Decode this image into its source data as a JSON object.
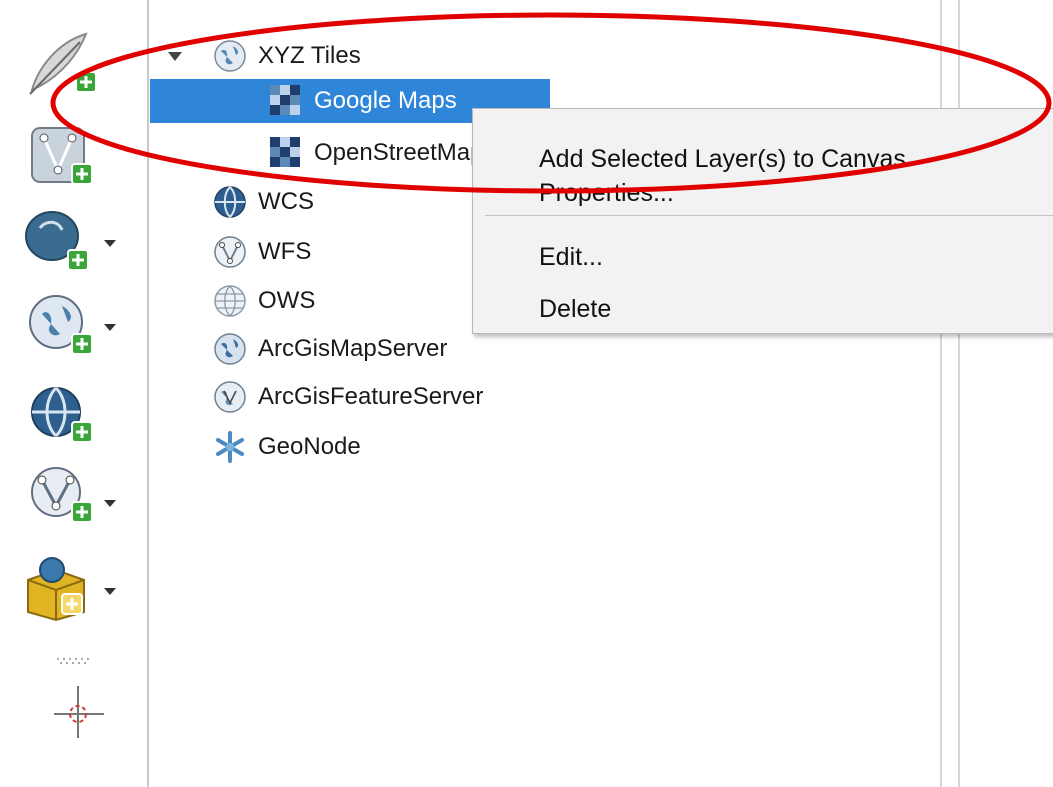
{
  "tree": {
    "xyz_tiles": "XYZ Tiles",
    "google_maps": "Google Maps",
    "openstreetmap": "OpenStreetMap",
    "wcs": "WCS",
    "wfs": "WFS",
    "ows": "OWS",
    "arcgis_map_server": "ArcGisMapServer",
    "arcgis_feature_server": "ArcGisFeatureServer",
    "geonode": "GeoNode"
  },
  "context_menu": {
    "add_selected": "Add Selected Layer(s) to Canvas",
    "properties": "Properties...",
    "edit": "Edit...",
    "delete": "Delete"
  },
  "colors": {
    "selection": "#2f86d8",
    "annotation": "#e00000",
    "toolbar_plus": "#3aa63a"
  },
  "icons": {
    "toolbar": [
      "new-layer-feather-icon",
      "add-vector-layer-icon",
      "add-postgis-layer-icon",
      "add-wms-layer-icon",
      "add-wcs-layer-icon",
      "add-wfs-layer-icon",
      "add-spatialite-layer-icon",
      "crosshair-icon"
    ],
    "tree": [
      "globe-icon",
      "tile-icon",
      "tile-icon",
      "globe-icon",
      "globe-icon",
      "globe-icon",
      "globe-icon",
      "globe-icon",
      "geonode-icon"
    ]
  }
}
